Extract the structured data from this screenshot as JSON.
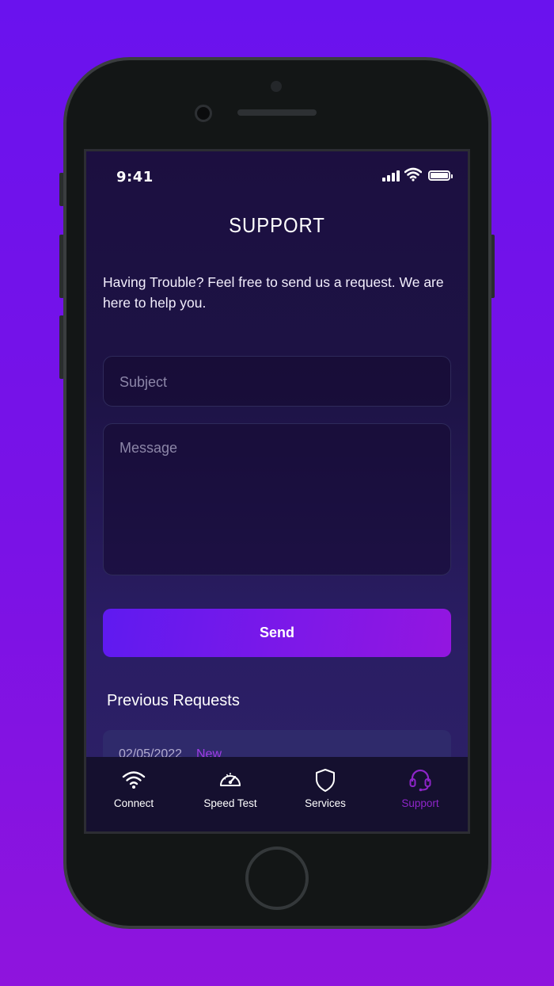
{
  "status_bar": {
    "time": "9:41"
  },
  "header": {
    "title": "SUPPORT"
  },
  "intro": {
    "text": "Having Trouble? Feel free to send us a request. We are here to help you."
  },
  "form": {
    "subject_placeholder": "Subject",
    "message_placeholder": "Message",
    "send_label": "Send"
  },
  "previous_requests": {
    "title": "Previous Requests",
    "items": [
      {
        "date": "02/05/2022",
        "status": "New"
      }
    ]
  },
  "tabs": [
    {
      "label": "Connect",
      "icon": "wifi-icon",
      "active": false
    },
    {
      "label": "Speed Test",
      "icon": "speedometer-icon",
      "active": false
    },
    {
      "label": "Services",
      "icon": "shield-icon",
      "active": false
    },
    {
      "label": "Support",
      "icon": "headset-icon",
      "active": true
    }
  ],
  "colors": {
    "accent": "#8e25c9",
    "button_gradient_start": "#5f1af0",
    "button_gradient_end": "#9316e0",
    "status_new": "#a13ce8"
  }
}
